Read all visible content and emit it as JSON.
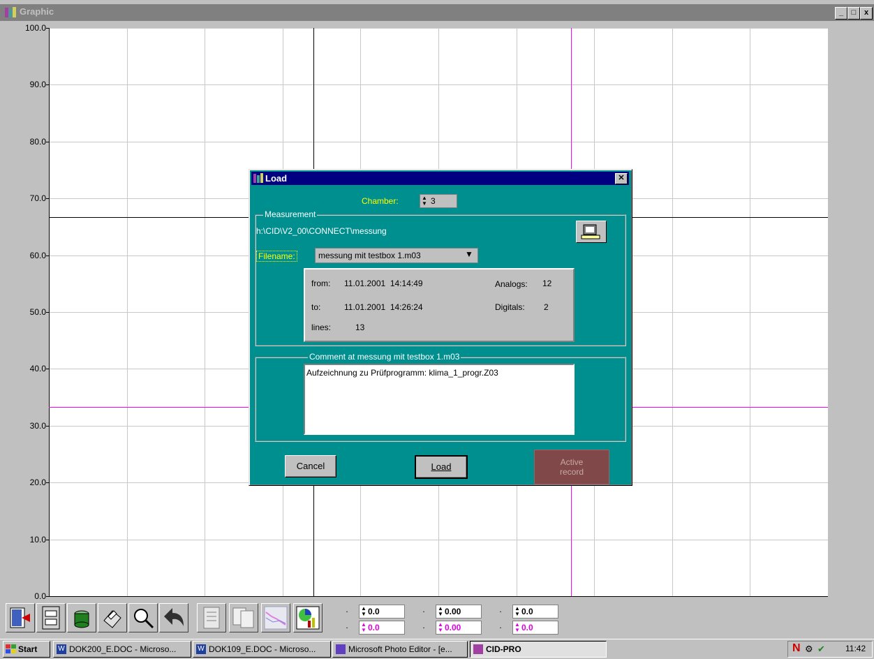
{
  "window": {
    "title": "Graphic",
    "controls": [
      "_",
      "□",
      "x"
    ]
  },
  "chart_data": {
    "type": "line",
    "title": "",
    "xlabel": "",
    "ylabel": "",
    "ylim": [
      0,
      100
    ],
    "y_ticks": [
      "100.0",
      "90.0",
      "80.0",
      "70.0",
      "60.0",
      "50.0",
      "40.0",
      "30.0",
      "20.0",
      "10.0",
      "0.0"
    ],
    "grid": true,
    "series": [],
    "cursors": {
      "black_horizontal_y": 66.7,
      "magenta_horizontal_y": 33.3
    }
  },
  "colors": {
    "dialog_bg": "#008f8f",
    "title_active": "#000080",
    "cursor_magenta": "#ff00ff",
    "label_yellow": "#ffff00"
  },
  "dialog": {
    "title": "Load",
    "chamber_label": "Chamber:",
    "chamber_value": "3",
    "measurement_group": "Measurement",
    "path": "h:\\CID\\V2_00\\CONNECT\\messung",
    "filename_label": "Filename:",
    "filename_value": "messung mit testbox 1.m03",
    "from_label": "from:",
    "from_value": "11.01.2001  14:14:49",
    "to_label": "to:",
    "to_value": "11.01.2001  14:26:24",
    "lines_label": "lines:",
    "lines_value": "13",
    "analogs_label": "Analogs:",
    "analogs_value": "12",
    "digitals_label": "Digitals:",
    "digitals_value": "2",
    "comment_group": "Comment at messung mit testbox 1.m03",
    "comment_text": "Aufzeichnung zu Prüfprogramm: klima_1_progr.Z03",
    "cancel_label": "Cancel",
    "load_label": "Load",
    "active_label_1": "Active",
    "active_label_2": "record"
  },
  "toolbar": {
    "icons": [
      "exit-icon",
      "file-cabinet-icon",
      "database-icon",
      "printer-icon",
      "zoom-icon",
      "undo-icon",
      "checklist-icon",
      "copy-pages-icon",
      "graph-icon",
      "statistics-icon"
    ],
    "fields": [
      {
        "dot1": ".",
        "dot2": ".",
        "value1": "0.0",
        "value2": "0.0"
      },
      {
        "dot1": ".",
        "dot2": ".",
        "value1": "0.00",
        "value2": "0.00"
      },
      {
        "dot1": ".",
        "dot2": ".",
        "value1": "0.0",
        "value2": "0.0"
      }
    ]
  },
  "taskbar": {
    "start": "Start",
    "tasks": [
      "DOK200_E.DOC - Microso...",
      "DOK109_E.DOC - Microso...",
      "Microsoft Photo Editor - [e...",
      "CID-PRO"
    ],
    "clock": "11:42"
  }
}
